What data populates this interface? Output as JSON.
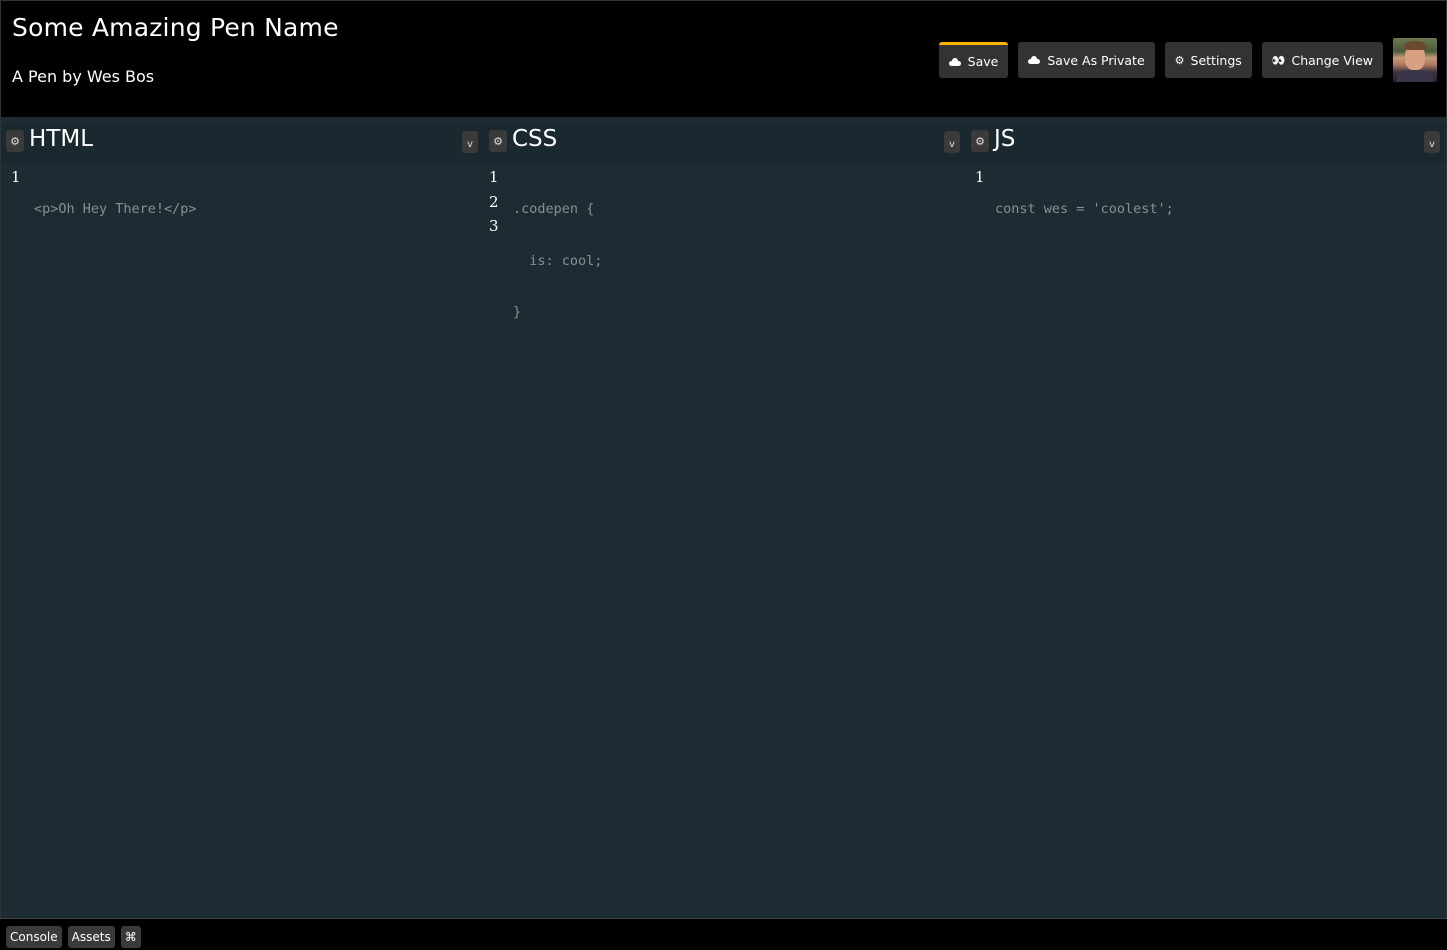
{
  "pen": {
    "title": "Some Amazing Pen Name",
    "byline": "A Pen by Wes Bos"
  },
  "toolbar": {
    "save_label": "Save",
    "save_private_label": "Save As Private",
    "settings_label": "Settings",
    "change_view_label": "Change View",
    "settings_icon": "⚙",
    "change_view_icon": "👀",
    "accent_color": "#ffb400"
  },
  "editors": {
    "html": {
      "title": "HTML",
      "gear_icon": "⚙",
      "collapse_icon": "v",
      "line_numbers": [
        "1"
      ],
      "lines": [
        "<p>Oh Hey There!</p>"
      ]
    },
    "css": {
      "title": "CSS",
      "gear_icon": "⚙",
      "collapse_icon": "v",
      "line_numbers": [
        "1",
        "2",
        "3"
      ],
      "lines": [
        ".codepen {",
        "  is: cool;",
        "}"
      ]
    },
    "js": {
      "title": "JS",
      "gear_icon": "⚙",
      "collapse_icon": "v",
      "line_numbers": [
        "1"
      ],
      "lines": [
        "const wes = 'coolest';"
      ]
    }
  },
  "footer": {
    "console_label": "Console",
    "assets_label": "Assets",
    "shortcuts_icon": "⌘"
  },
  "colors": {
    "editor_bg": "#1d2b33",
    "header_bg": "#000000",
    "button_bg": "#333333"
  }
}
